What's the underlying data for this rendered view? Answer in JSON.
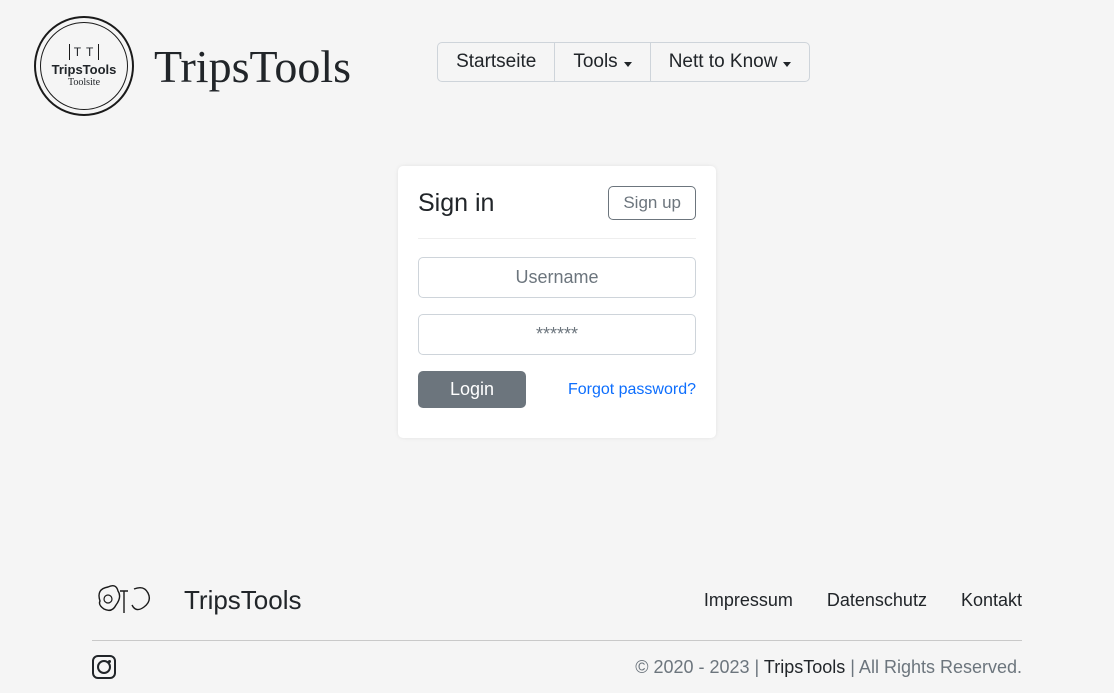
{
  "logo": {
    "monogram": "T T",
    "brand_small": "TripsTools",
    "sub": "Toolsite"
  },
  "brand": "TripsTools",
  "nav": {
    "home": "Startseite",
    "tools": "Tools",
    "nett": "Nett to Know"
  },
  "signin": {
    "title": "Sign in",
    "signup": "Sign up",
    "username_placeholder": "Username",
    "password_placeholder": "******",
    "login": "Login",
    "forgot": "Forgot password?"
  },
  "footer": {
    "brand": "TripsTools",
    "links": {
      "impressum": "Impressum",
      "datenschutz": "Datenschutz",
      "kontakt": "Kontakt"
    },
    "copyright_prefix": "© 2020 - 2023 | ",
    "copyright_brand": "TripsTools",
    "copyright_suffix": " | All Rights Reserved."
  }
}
